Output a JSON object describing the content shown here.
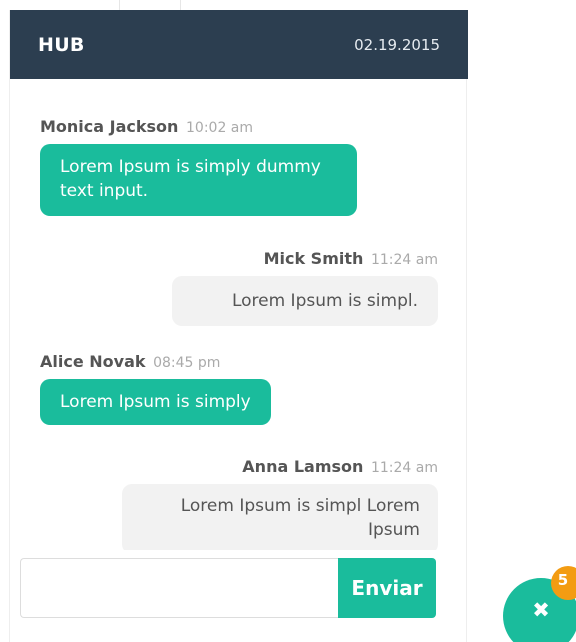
{
  "chat": {
    "title": "HUB",
    "date": "02.19.2015",
    "messages": [
      {
        "sender": "Monica Jackson",
        "time": "10:02 am",
        "text": "Lorem Ipsum is simply dummy text input.",
        "direction": "incoming"
      },
      {
        "sender": "Mick Smith",
        "time": "11:24 am",
        "text": "Lorem Ipsum is simpl.",
        "direction": "outgoing"
      },
      {
        "sender": "Alice Novak",
        "time": "08:45 pm",
        "text": "Lorem Ipsum is simply",
        "direction": "incoming"
      },
      {
        "sender": "Anna Lamson",
        "time": "11:24 am",
        "text": "Lorem Ipsum is simpl Lorem Ipsum",
        "direction": "outgoing"
      }
    ]
  },
  "composer": {
    "input_value": "",
    "input_placeholder": "",
    "send_label": "Enviar"
  },
  "toggle": {
    "icon": "close-icon",
    "glyph": "✖",
    "badge_count": "5"
  },
  "colors": {
    "header_bg": "#2c3e50",
    "accent": "#1abc9c",
    "badge": "#f39c12",
    "outgoing_bubble": "#f2f2f2"
  }
}
